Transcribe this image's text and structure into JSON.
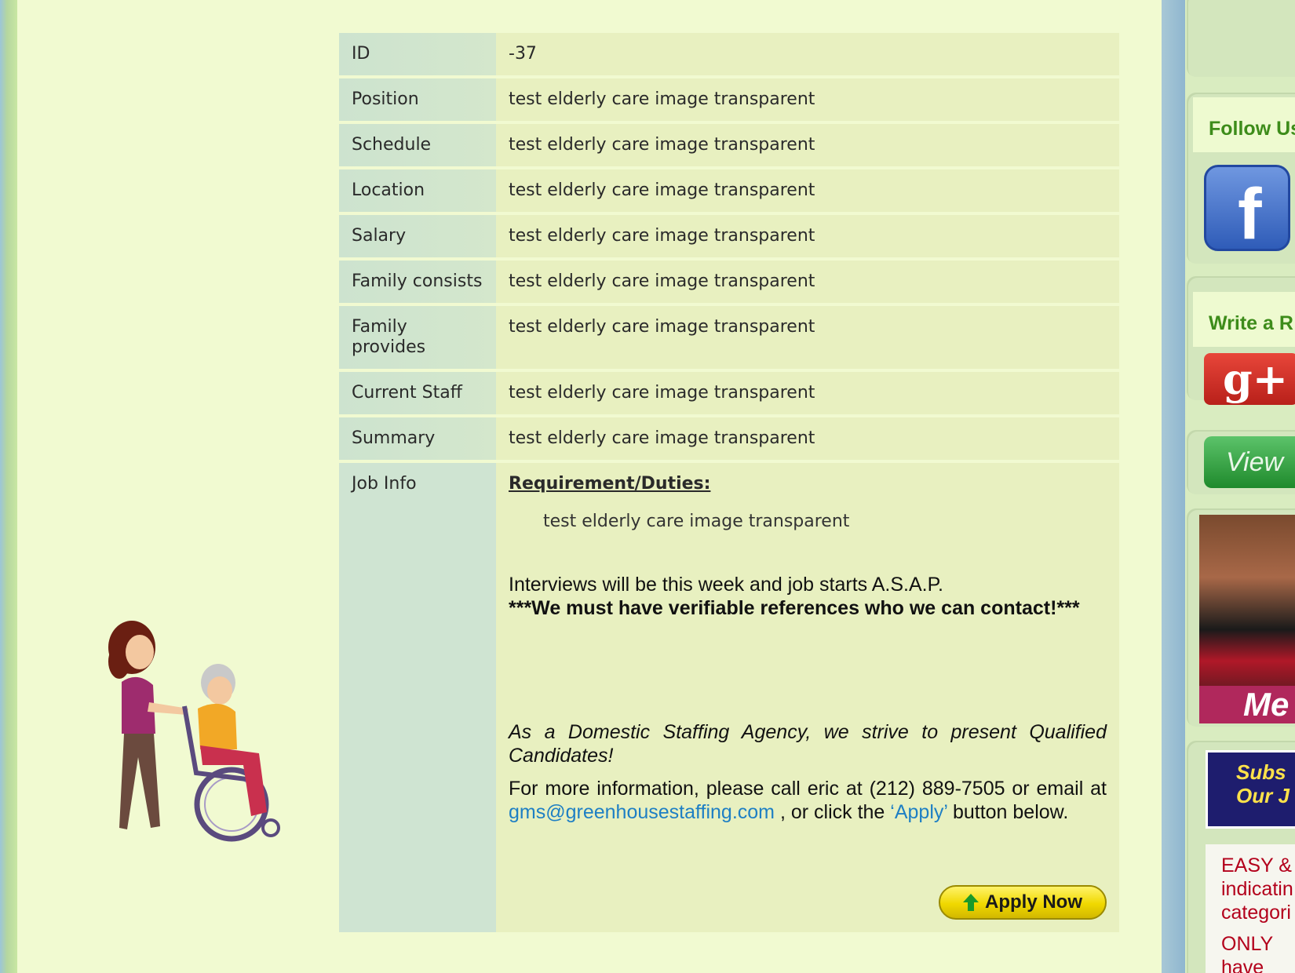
{
  "job": {
    "rows": [
      {
        "label": "ID",
        "value": "-37"
      },
      {
        "label": "Position",
        "value": "test elderly care image transparent"
      },
      {
        "label": "Schedule",
        "value": "test elderly care image transparent"
      },
      {
        "label": "Location",
        "value": "test elderly care image transparent"
      },
      {
        "label": "Salary",
        "value": "test elderly care image transparent"
      },
      {
        "label": "Family consists",
        "value": "test elderly care image transparent"
      },
      {
        "label": "Family provides",
        "value": "test elderly care image transparent"
      },
      {
        "label": "Current Staff",
        "value": "test elderly care image transparent"
      },
      {
        "label": "Summary",
        "value": "test elderly care image transparent"
      }
    ],
    "job_info_label": "Job Info",
    "requirements_heading": "Requirement/Duties:",
    "requirements_text": "test elderly care image transparent",
    "interview_line": "Interviews will be this week and job starts A.S.A.P.",
    "references_line": "***We must have verifiable references who we can contact!***",
    "agency_line": "As a Domestic Staffing Agency, we strive to present Qualified Candidates!",
    "more_info_prefix": "For more information, please call eric at (212) 889-7505 or email at",
    "email": "gms@greenhousestaffing.com",
    "more_info_middle": ", or click the",
    "apply_link": "‘Apply’",
    "more_info_suffix": "button below.",
    "apply_button": "Apply Now"
  },
  "sidebar": {
    "follow_heading": "Follow Us",
    "review_heading": "Write a R",
    "view_button": "View",
    "promo_caption": "Me",
    "subscribe_line1": "Subs",
    "subscribe_line2": "Our J",
    "easy_lines": [
      "EASY &",
      "indicatin",
      "categori",
      "ONLY",
      "have"
    ]
  },
  "colors": {
    "page_bg": "#f1fad1",
    "label_bg": "#cde3cf",
    "value_bg": "#e8f0c0",
    "link": "#1e7fc4",
    "sidebar_heading": "#3d8c1a"
  }
}
